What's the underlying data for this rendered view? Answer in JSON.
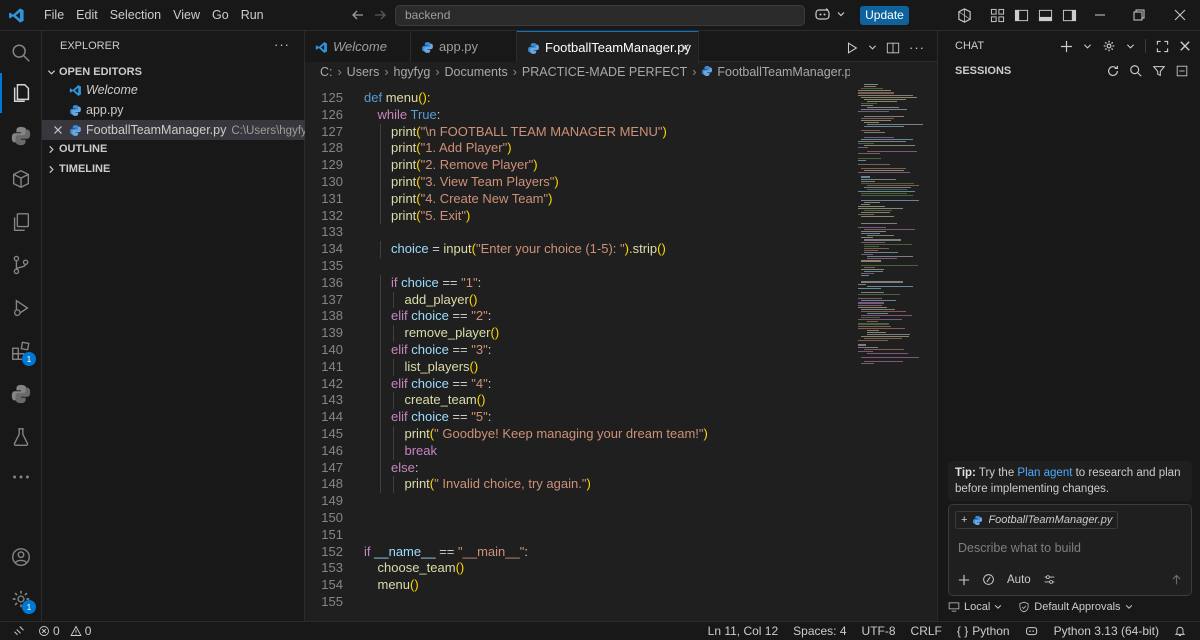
{
  "titlebar": {
    "menus": [
      "File",
      "Edit",
      "Selection",
      "View",
      "Go",
      "Run"
    ],
    "search_text": "backend",
    "update_label": "Update"
  },
  "sidebar": {
    "title": "EXPLORER",
    "open_editors_label": "OPEN EDITORS",
    "open_editors": [
      {
        "name": "Welcome",
        "italic": true,
        "icon": "vscode-icon"
      },
      {
        "name": "app.py",
        "italic": false,
        "icon": "python-icon"
      },
      {
        "name": "FootballTeamManager.py",
        "path": "C:\\Users\\hgyfyg\\...",
        "italic": false,
        "icon": "python-icon",
        "selected": true
      }
    ],
    "outline_label": "OUTLINE",
    "timeline_label": "TIMELINE"
  },
  "activity": {
    "extensions_badge": "1",
    "accounts_badge": "1"
  },
  "tabs": [
    {
      "label": "Welcome",
      "icon": "vscode-icon",
      "active": false
    },
    {
      "label": "app.py",
      "icon": "python-icon",
      "active": false
    },
    {
      "label": "FootballTeamManager.py",
      "icon": "python-icon",
      "active": true
    }
  ],
  "breadcrumb": [
    "C:",
    "Users",
    "hgyfyg",
    "Documents",
    "PRACTICE-MADE PERFECT",
    "FootballTeamManager.py",
    "..."
  ],
  "colors": {
    "accent": "#0078d4",
    "keyword": "#c586c0",
    "function": "#dcdcaa",
    "string": "#ce9178",
    "variable": "#9cdcfe",
    "constant": "#569cd6",
    "punct": "#ffd700"
  },
  "code_lines": [
    {
      "n": "125",
      "indent": 0,
      "tokens": [
        {
          "t": "def ",
          "c": "constant"
        },
        {
          "t": "menu",
          "c": "function"
        },
        {
          "t": "():",
          "c": "punct"
        }
      ]
    },
    {
      "n": "126",
      "indent": 1,
      "tokens": [
        {
          "t": "while ",
          "c": "keyword"
        },
        {
          "t": "True",
          "c": "constant"
        },
        {
          "t": ":",
          "c": "plain"
        }
      ]
    },
    {
      "n": "127",
      "indent": 2,
      "tokens": [
        {
          "t": "print",
          "c": "function"
        },
        {
          "t": "(",
          "c": "paren"
        },
        {
          "t": "\"\\n FOOTBALL TEAM MANAGER MENU\"",
          "c": "string"
        },
        {
          "t": ")",
          "c": "paren"
        }
      ]
    },
    {
      "n": "128",
      "indent": 2,
      "tokens": [
        {
          "t": "print",
          "c": "function"
        },
        {
          "t": "(",
          "c": "paren"
        },
        {
          "t": "\"1. Add Player\"",
          "c": "string"
        },
        {
          "t": ")",
          "c": "paren"
        }
      ]
    },
    {
      "n": "129",
      "indent": 2,
      "tokens": [
        {
          "t": "print",
          "c": "function"
        },
        {
          "t": "(",
          "c": "paren"
        },
        {
          "t": "\"2. Remove Player\"",
          "c": "string"
        },
        {
          "t": ")",
          "c": "paren"
        }
      ]
    },
    {
      "n": "130",
      "indent": 2,
      "tokens": [
        {
          "t": "print",
          "c": "function"
        },
        {
          "t": "(",
          "c": "paren"
        },
        {
          "t": "\"3. View Team Players\"",
          "c": "string"
        },
        {
          "t": ")",
          "c": "paren"
        }
      ]
    },
    {
      "n": "131",
      "indent": 2,
      "tokens": [
        {
          "t": "print",
          "c": "function"
        },
        {
          "t": "(",
          "c": "paren"
        },
        {
          "t": "\"4. Create New Team\"",
          "c": "string"
        },
        {
          "t": ")",
          "c": "paren"
        }
      ]
    },
    {
      "n": "132",
      "indent": 2,
      "tokens": [
        {
          "t": "print",
          "c": "function"
        },
        {
          "t": "(",
          "c": "paren"
        },
        {
          "t": "\"5. Exit\"",
          "c": "string"
        },
        {
          "t": ")",
          "c": "paren"
        }
      ]
    },
    {
      "n": "133",
      "indent": 0,
      "tokens": []
    },
    {
      "n": "134",
      "indent": 2,
      "tokens": [
        {
          "t": "choice",
          "c": "variable"
        },
        {
          "t": " = ",
          "c": "plain"
        },
        {
          "t": "input",
          "c": "function"
        },
        {
          "t": "(",
          "c": "paren"
        },
        {
          "t": "\"Enter your choice (1-5): \"",
          "c": "string"
        },
        {
          "t": ").",
          "c": "paren"
        },
        {
          "t": "strip",
          "c": "function"
        },
        {
          "t": "()",
          "c": "paren"
        }
      ]
    },
    {
      "n": "135",
      "indent": 0,
      "tokens": []
    },
    {
      "n": "136",
      "indent": 2,
      "tokens": [
        {
          "t": "if ",
          "c": "keyword"
        },
        {
          "t": "choice",
          "c": "variable"
        },
        {
          "t": " == ",
          "c": "plain"
        },
        {
          "t": "\"1\"",
          "c": "string"
        },
        {
          "t": ":",
          "c": "plain"
        }
      ]
    },
    {
      "n": "137",
      "indent": 3,
      "tokens": [
        {
          "t": "add_player",
          "c": "function"
        },
        {
          "t": "()",
          "c": "paren"
        }
      ]
    },
    {
      "n": "138",
      "indent": 2,
      "tokens": [
        {
          "t": "elif ",
          "c": "keyword"
        },
        {
          "t": "choice",
          "c": "variable"
        },
        {
          "t": " == ",
          "c": "plain"
        },
        {
          "t": "\"2\"",
          "c": "string"
        },
        {
          "t": ":",
          "c": "plain"
        }
      ]
    },
    {
      "n": "139",
      "indent": 3,
      "tokens": [
        {
          "t": "remove_player",
          "c": "function"
        },
        {
          "t": "()",
          "c": "paren"
        }
      ]
    },
    {
      "n": "140",
      "indent": 2,
      "tokens": [
        {
          "t": "elif ",
          "c": "keyword"
        },
        {
          "t": "choice",
          "c": "variable"
        },
        {
          "t": " == ",
          "c": "plain"
        },
        {
          "t": "\"3\"",
          "c": "string"
        },
        {
          "t": ":",
          "c": "plain"
        }
      ]
    },
    {
      "n": "141",
      "indent": 3,
      "tokens": [
        {
          "t": "list_players",
          "c": "function"
        },
        {
          "t": "()",
          "c": "paren"
        }
      ]
    },
    {
      "n": "142",
      "indent": 2,
      "tokens": [
        {
          "t": "elif ",
          "c": "keyword"
        },
        {
          "t": "choice",
          "c": "variable"
        },
        {
          "t": " == ",
          "c": "plain"
        },
        {
          "t": "\"4\"",
          "c": "string"
        },
        {
          "t": ":",
          "c": "plain"
        }
      ]
    },
    {
      "n": "143",
      "indent": 3,
      "tokens": [
        {
          "t": "create_team",
          "c": "function"
        },
        {
          "t": "()",
          "c": "paren"
        }
      ]
    },
    {
      "n": "144",
      "indent": 2,
      "tokens": [
        {
          "t": "elif ",
          "c": "keyword"
        },
        {
          "t": "choice",
          "c": "variable"
        },
        {
          "t": " == ",
          "c": "plain"
        },
        {
          "t": "\"5\"",
          "c": "string"
        },
        {
          "t": ":",
          "c": "plain"
        }
      ]
    },
    {
      "n": "145",
      "indent": 3,
      "tokens": [
        {
          "t": "print",
          "c": "function"
        },
        {
          "t": "(",
          "c": "paren"
        },
        {
          "t": "\" Goodbye! Keep managing your dream team!\"",
          "c": "string"
        },
        {
          "t": ")",
          "c": "paren"
        }
      ]
    },
    {
      "n": "146",
      "indent": 3,
      "tokens": [
        {
          "t": "break",
          "c": "keyword"
        }
      ]
    },
    {
      "n": "147",
      "indent": 2,
      "tokens": [
        {
          "t": "else",
          "c": "keyword"
        },
        {
          "t": ":",
          "c": "plain"
        }
      ]
    },
    {
      "n": "148",
      "indent": 3,
      "tokens": [
        {
          "t": "print",
          "c": "function"
        },
        {
          "t": "(",
          "c": "paren"
        },
        {
          "t": "\" Invalid choice, try again.\"",
          "c": "string"
        },
        {
          "t": ")",
          "c": "paren"
        }
      ]
    },
    {
      "n": "149",
      "indent": 0,
      "tokens": []
    },
    {
      "n": "150",
      "indent": 0,
      "tokens": []
    },
    {
      "n": "151",
      "indent": 0,
      "tokens": []
    },
    {
      "n": "152",
      "indent": 0,
      "tokens": [
        {
          "t": "if ",
          "c": "keyword"
        },
        {
          "t": "__name__",
          "c": "variable"
        },
        {
          "t": " == ",
          "c": "plain"
        },
        {
          "t": "\"__main__\"",
          "c": "string"
        },
        {
          "t": ":",
          "c": "plain"
        }
      ]
    },
    {
      "n": "153",
      "indent": 1,
      "tokens": [
        {
          "t": "choose_team",
          "c": "function"
        },
        {
          "t": "()",
          "c": "paren"
        }
      ]
    },
    {
      "n": "154",
      "indent": 1,
      "tokens": [
        {
          "t": "menu",
          "c": "function"
        },
        {
          "t": "()",
          "c": "paren"
        }
      ]
    },
    {
      "n": "155",
      "indent": 0,
      "tokens": []
    }
  ],
  "chat": {
    "title": "CHAT",
    "sessions_label": "SESSIONS",
    "tip_prefix": "Tip:",
    "tip_text1": " Try the ",
    "tip_link": "Plan agent",
    "tip_text2": " to research and plan before implementing changes.",
    "context_file": "FootballTeamManager.py",
    "input_placeholder": "Describe what to build",
    "mode_label": "Auto",
    "local_label": "Local",
    "approvals_label": "Default Approvals"
  },
  "status": {
    "errors": "0",
    "warnings": "0",
    "position": "Ln 11, Col 12",
    "spaces": "Spaces: 4",
    "encoding": "UTF-8",
    "eol": "CRLF",
    "language": "Python",
    "interpreter": "Python 3.13 (64-bit)"
  }
}
